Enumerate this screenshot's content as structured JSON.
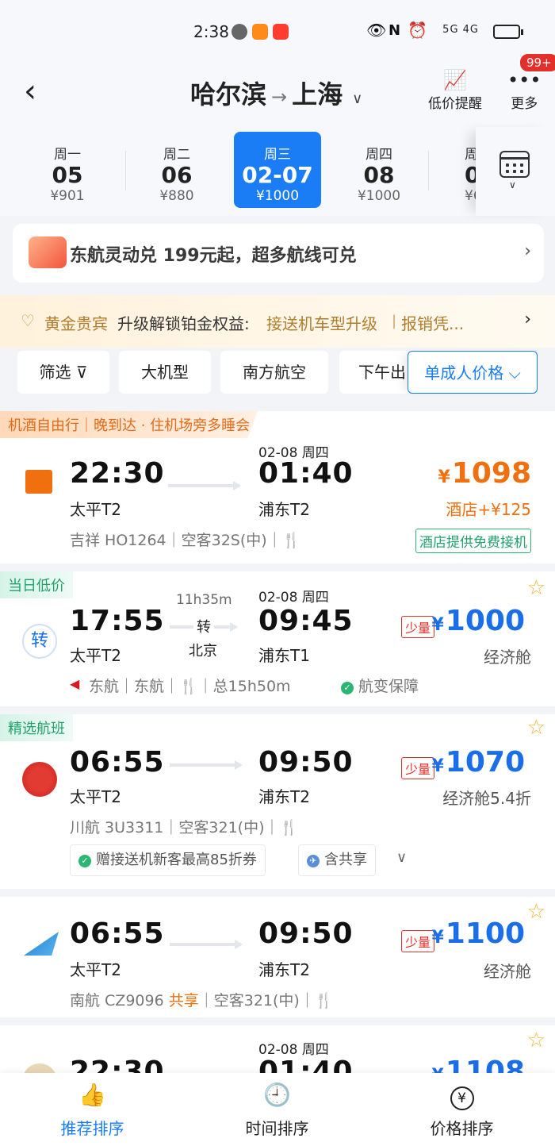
{
  "status_bar": {
    "time": "2:38",
    "network": "5G 4G"
  },
  "header": {
    "origin": "哈尔滨",
    "destination": "上海",
    "price_alert_label": "低价提醒",
    "more_label": "更多",
    "more_badge": "99+"
  },
  "dates": [
    {
      "weekday": "周一",
      "date": "05",
      "price": "¥901"
    },
    {
      "weekday": "周二",
      "date": "06",
      "price": "¥880"
    },
    {
      "weekday": "周三",
      "date": "02-07",
      "price": "¥1000",
      "selected": true
    },
    {
      "weekday": "周四",
      "date": "08",
      "price": "¥1000"
    },
    {
      "weekday": "周",
      "date": "0",
      "price": "¥6"
    }
  ],
  "promo": {
    "text": "东航灵动兑 199元起，超多航线可兑"
  },
  "gold_bar": {
    "level": "黄金贵宾",
    "text": "升级解锁铂金权益:",
    "benefit1": "接送机车型升级",
    "sep": "|",
    "benefit2": "报销凭..."
  },
  "filters": [
    {
      "label": "筛选 ⊽"
    },
    {
      "label": "大机型"
    },
    {
      "label": "南方航空"
    },
    {
      "label": "下午出"
    },
    {
      "label": "单成人价格 ⌵",
      "selected": true
    }
  ],
  "flights": [
    {
      "tag": "机酒自由行｜晚到达 · 住机场旁多睡会",
      "dep_time": "22:30",
      "dep_airport": "太平T2",
      "arr_date": "02-08 周四",
      "arr_time": "01:40",
      "arr_airport": "浦东T2",
      "price_symbol": "¥",
      "price": "1098",
      "sub": "酒店+¥125",
      "meta": "吉祥 HO1264｜空客32S(中)｜🍴",
      "extra": "酒店提供免费接机",
      "price_color": "#f0700f"
    },
    {
      "tag": "当日低价",
      "dep_time": "17:55",
      "dep_airport": "太平T2",
      "duration": "11h35m",
      "transfer": "转",
      "transfer_city": "北京",
      "arr_date": "02-08 周四",
      "arr_time": "09:45",
      "arr_airport": "浦东T1",
      "qty": "少量",
      "price_symbol": "¥",
      "price": "1000",
      "sub": "经济舱",
      "meta": "东航｜东航｜🍴｜总15h50m",
      "guarantee": "航变保障",
      "price_color": "#1a6fe8",
      "logo_text": "转"
    },
    {
      "tag": "精选航班",
      "dep_time": "06:55",
      "dep_airport": "太平T2",
      "arr_time": "09:50",
      "arr_airport": "浦东T2",
      "qty": "少量",
      "price_symbol": "¥",
      "price": "1070",
      "sub": "经济舱5.4折",
      "meta": "川航 3U3311｜空客321(中)｜🍴",
      "pill1": "赠接送机新客最高85折券",
      "pill2": "含共享",
      "price_color": "#1a6fe8"
    },
    {
      "dep_time": "06:55",
      "dep_airport": "太平T2",
      "arr_time": "09:50",
      "arr_airport": "浦东T2",
      "qty": "少量",
      "price_symbol": "¥",
      "price": "1100",
      "sub": "经济舱",
      "meta_a": "南航 CZ9096",
      "meta_share": "共享",
      "meta_b": "｜空客321(中)｜🍴",
      "price_color": "#1a6fe8"
    },
    {
      "dep_time": "22:30",
      "arr_date": "02-08 周四",
      "arr_time": "01:40",
      "price_symbol": "¥",
      "price": "1108",
      "price_color": "#1a6fe8"
    }
  ],
  "bottom_nav": [
    {
      "label": "推荐排序",
      "icon": "thumbs-up-icon",
      "selected": true
    },
    {
      "label": "时间排序",
      "icon": "clock-icon"
    },
    {
      "label": "价格排序",
      "icon": "yen-icon"
    }
  ],
  "colors": {
    "accent": "#1a7df5",
    "orange": "#f0700f",
    "red": "#e3302a",
    "green": "#21a16b"
  }
}
